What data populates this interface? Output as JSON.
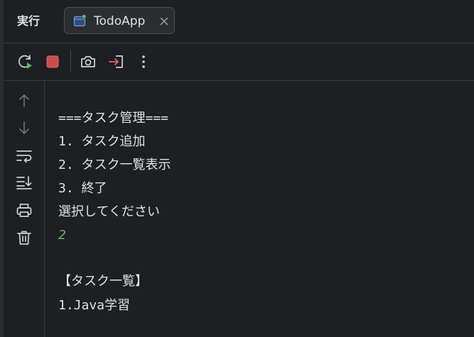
{
  "panel": {
    "title": "実行"
  },
  "tab": {
    "label": "TodoApp",
    "active": true,
    "status_color": "#5fb865"
  },
  "toolbar": {
    "buttons": [
      "rerun-icon",
      "stop-icon",
      "camera-icon",
      "exit-icon",
      "more-icon"
    ],
    "stop_color": "#c94f4f"
  },
  "sidebar": {
    "buttons": [
      "arrow-up-icon",
      "arrow-down-icon",
      "soft-wrap-icon",
      "scroll-to-end-icon",
      "print-icon",
      "trash-icon"
    ]
  },
  "console": {
    "lines": [
      "===タスク管理===",
      "1. タスク追加",
      "2. タスク一覧表示",
      "3. 終了",
      "選択してください",
      "2",
      "",
      "【タスク一覧】",
      "1.Java学習"
    ],
    "input_color": "#5fb865"
  }
}
